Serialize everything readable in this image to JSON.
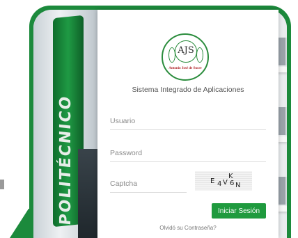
{
  "background": {
    "sign_text": "POLITÉCNICO",
    "accent_color": "#1c8a3c"
  },
  "logo": {
    "monogram": "AJS",
    "name": "Antonio José de Sucre"
  },
  "app_title": "Sistema Integrado de Aplicaciones",
  "form": {
    "username_placeholder": "Usuario",
    "password_placeholder": "Password",
    "captcha_placeholder": "Captcha",
    "captcha_chars": [
      "E",
      "4",
      "V",
      "K",
      "6",
      "N"
    ]
  },
  "login_button_label": "Iniciar Sesión",
  "forgot_password_link": "Olvidó su Contraseña?"
}
